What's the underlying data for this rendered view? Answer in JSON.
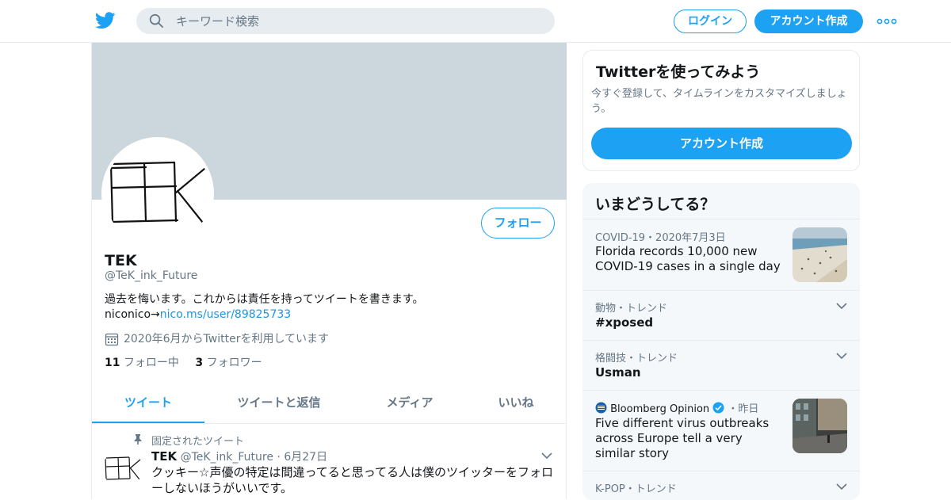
{
  "topbar": {
    "search_placeholder": "キーワード検索",
    "login_label": "ログイン",
    "signup_label": "アカウント作成"
  },
  "profile": {
    "name": "TEK",
    "handle": "@TeK_ink_Future",
    "bio_line1": "過去を悔います。これからは責任を持ってツイートを書きます。",
    "bio_line2_prefix": "niconico→",
    "bio_link": "nico.ms/user/89825733",
    "joined": "2020年6月からTwitterを利用しています",
    "following_count": "11",
    "following_label": "フォロー中",
    "followers_count": "3",
    "followers_label": "フォロワー",
    "follow_button": "フォロー"
  },
  "tabs": [
    "ツイート",
    "ツイートと返信",
    "メディア",
    "いいね"
  ],
  "pinned_tweet": {
    "pinned_label": "固定されたツイート",
    "author": "TEK",
    "handle": "@TeK_ink_Future",
    "date": "6月27日",
    "text": "クッキー☆声優の特定は間違ってると思ってる人は僕のツイッターをフォローしないほうがいいです。"
  },
  "signup_card": {
    "title": "Twitterを使ってみよう",
    "description": "今すぐ登録して、タイムラインをカスタマイズしましょう。",
    "button": "アカウント作成"
  },
  "trends": {
    "title": "いまどうしてる？",
    "items": [
      {
        "meta": "COVID-19・2020年7月3日",
        "title": "Florida records 10,000 new COVID-19 cases in a single day"
      },
      {
        "meta": "動物・トレンド",
        "title": "#xposed"
      },
      {
        "meta": "格闘技・トレンド",
        "title": "Usman"
      },
      {
        "meta_source": "Bloomberg Opinion",
        "meta_time": "・昨日",
        "title": "Five different virus outbreaks across Europe tell a very similar story"
      },
      {
        "meta": "K-POP・トレンド",
        "title": ""
      }
    ]
  },
  "colors": {
    "accent": "#1da1f2",
    "banner": "#ccd6dd",
    "secondary_text": "#657786"
  }
}
